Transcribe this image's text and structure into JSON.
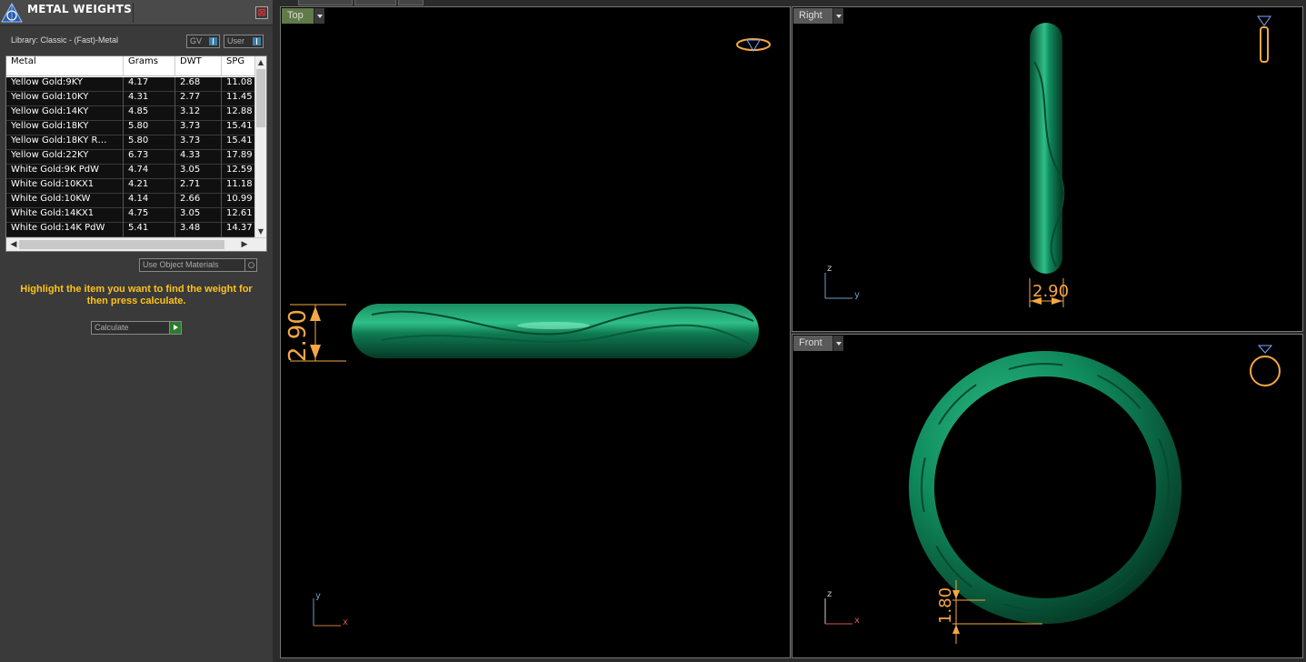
{
  "panel": {
    "title": "METAL WEIGHTS",
    "close": "⊠",
    "library": "Library: Classic - (Fast)-Metal",
    "gv_label": "GV",
    "user_label": "User",
    "table": {
      "headers": [
        "Metal",
        "Grams",
        "DWT",
        "SPG"
      ],
      "rows": [
        [
          "Yellow Gold:9KY",
          "4.17",
          "2.68",
          "11.08"
        ],
        [
          "Yellow Gold:10KY",
          "4.31",
          "2.77",
          "11.45"
        ],
        [
          "Yellow Gold:14KY",
          "4.85",
          "3.12",
          "12.88"
        ],
        [
          "Yellow Gold:18KY",
          "5.80",
          "3.73",
          "15.41"
        ],
        [
          "Yellow Gold:18KY R…",
          "5.80",
          "3.73",
          "15.41"
        ],
        [
          "Yellow Gold:22KY",
          "6.73",
          "4.33",
          "17.89"
        ],
        [
          "White Gold:9K PdW",
          "4.74",
          "3.05",
          "12.59"
        ],
        [
          "White Gold:10KX1",
          "4.21",
          "2.71",
          "11.18"
        ],
        [
          "White Gold:10KW",
          "4.14",
          "2.66",
          "10.99"
        ],
        [
          "White Gold:14KX1",
          "4.75",
          "3.05",
          "12.61"
        ],
        [
          "White Gold:14K PdW",
          "5.41",
          "3.48",
          "14.37"
        ]
      ]
    },
    "use_object_materials": "Use Object Materials",
    "hint": "Highlight the item you want to find the weight for then press calculate.",
    "calculate": "Calculate"
  },
  "viewports": {
    "top": {
      "label": "Top",
      "dimension": "2.90",
      "axis_v": "y",
      "axis_h": "x"
    },
    "right": {
      "label": "Right",
      "dimension": "2.90",
      "axis_v": "z",
      "axis_h": "y"
    },
    "front": {
      "label": "Front",
      "dimension": "1.80",
      "axis_v": "z",
      "axis_h": "x"
    }
  },
  "colors": {
    "ring_green": "#0f8a5c",
    "dimension_orange": "#f4a742",
    "hint_yellow": "#ffc21a"
  }
}
